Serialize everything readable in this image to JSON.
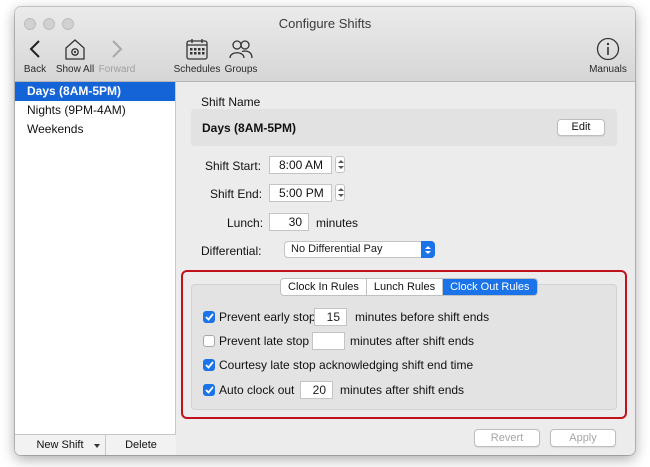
{
  "window": {
    "title": "Configure Shifts"
  },
  "toolbar": {
    "back": "Back",
    "show_all": "Show All",
    "forward": "Forward",
    "schedules": "Schedules",
    "groups": "Groups",
    "manuals": "Manuals"
  },
  "sidebar": {
    "items": [
      {
        "label": "Days (8AM-5PM)",
        "selected": true
      },
      {
        "label": "Nights (9PM-4AM)",
        "selected": false
      },
      {
        "label": "Weekends",
        "selected": false
      }
    ],
    "new_shift": "New Shift",
    "delete": "Delete"
  },
  "main": {
    "shift_name_label": "Shift Name",
    "shift_name_value": "Days (8AM-5PM)",
    "edit_button": "Edit",
    "shift_start_label": "Shift Start:",
    "shift_start_value": "8:00 AM",
    "shift_end_label": "Shift End:",
    "shift_end_value": "5:00 PM",
    "lunch_label": "Lunch:",
    "lunch_value": "30",
    "lunch_units": "minutes",
    "differential_label": "Differential:",
    "differential_value": "No Differential Pay",
    "revert": "Revert",
    "apply": "Apply"
  },
  "rules": {
    "tabs": [
      "Clock In Rules",
      "Lunch Rules",
      "Clock Out Rules"
    ],
    "active_tab": "Clock Out Rules",
    "prevent_early_label": "Prevent early stop",
    "prevent_early_checked": true,
    "prevent_early_value": "15",
    "prevent_early_suffix": "minutes before shift ends",
    "prevent_late_label": "Prevent late stop",
    "prevent_late_checked": false,
    "prevent_late_value": "",
    "prevent_late_suffix": "minutes after shift ends",
    "courtesy_label": "Courtesy late stop acknowledging shift end time",
    "courtesy_checked": true,
    "auto_clock_label": "Auto clock out",
    "auto_clock_checked": true,
    "auto_clock_value": "20",
    "auto_clock_suffix": "minutes after shift ends"
  },
  "colors": {
    "accent": "#1a73e8",
    "selection": "#1464d8",
    "highlight_border": "#c1121c"
  },
  "icons": [
    "chevron-left-icon",
    "gear-house-icon",
    "chevron-right-icon",
    "calendar-icon",
    "people-icon",
    "info-icon",
    "checkmark-icon"
  ]
}
